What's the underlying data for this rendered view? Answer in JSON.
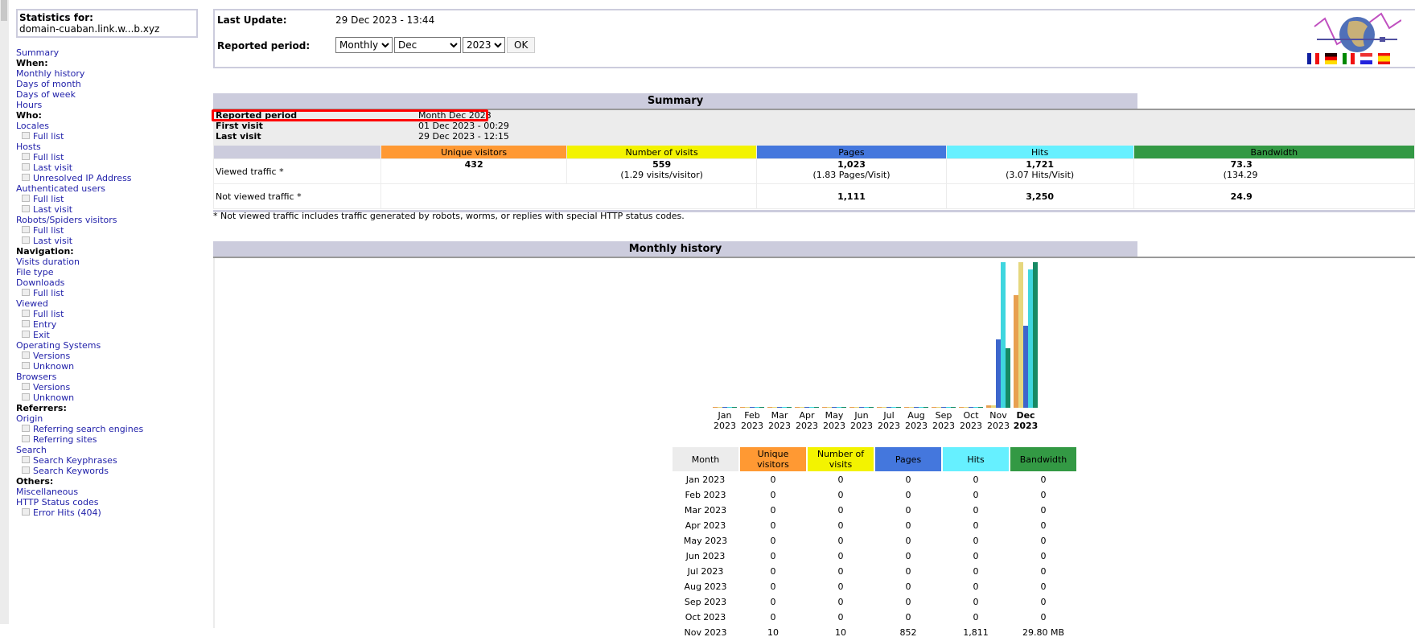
{
  "sidebar": {
    "stats_label": "Statistics for:",
    "domain": "domain-cuaban.link.w...b.xyz",
    "items": [
      {
        "type": "link",
        "label": "Summary"
      },
      {
        "type": "section",
        "label": "When:"
      },
      {
        "type": "link",
        "label": "Monthly history"
      },
      {
        "type": "link",
        "label": "Days of month"
      },
      {
        "type": "link",
        "label": "Days of week"
      },
      {
        "type": "link",
        "label": "Hours"
      },
      {
        "type": "section",
        "label": "Who:"
      },
      {
        "type": "link",
        "label": "Locales"
      },
      {
        "type": "sub",
        "label": "Full list"
      },
      {
        "type": "link",
        "label": "Hosts"
      },
      {
        "type": "sub",
        "label": "Full list"
      },
      {
        "type": "sub",
        "label": "Last visit"
      },
      {
        "type": "sub",
        "label": "Unresolved IP Address"
      },
      {
        "type": "link",
        "label": "Authenticated users"
      },
      {
        "type": "sub",
        "label": "Full list"
      },
      {
        "type": "sub",
        "label": "Last visit"
      },
      {
        "type": "link",
        "label": "Robots/Spiders visitors"
      },
      {
        "type": "sub",
        "label": "Full list"
      },
      {
        "type": "sub",
        "label": "Last visit"
      },
      {
        "type": "section",
        "label": "Navigation:"
      },
      {
        "type": "link",
        "label": "Visits duration"
      },
      {
        "type": "link",
        "label": "File type"
      },
      {
        "type": "link",
        "label": "Downloads"
      },
      {
        "type": "sub",
        "label": "Full list"
      },
      {
        "type": "link",
        "label": "Viewed"
      },
      {
        "type": "sub",
        "label": "Full list"
      },
      {
        "type": "sub",
        "label": "Entry"
      },
      {
        "type": "sub",
        "label": "Exit"
      },
      {
        "type": "link",
        "label": "Operating Systems"
      },
      {
        "type": "sub",
        "label": "Versions"
      },
      {
        "type": "sub",
        "label": "Unknown"
      },
      {
        "type": "link",
        "label": "Browsers"
      },
      {
        "type": "sub",
        "label": "Versions"
      },
      {
        "type": "sub",
        "label": "Unknown"
      },
      {
        "type": "section",
        "label": "Referrers:"
      },
      {
        "type": "link",
        "label": "Origin"
      },
      {
        "type": "sub",
        "label": "Referring search engines"
      },
      {
        "type": "sub",
        "label": "Referring sites"
      },
      {
        "type": "link",
        "label": "Search"
      },
      {
        "type": "sub",
        "label": "Search Keyphrases"
      },
      {
        "type": "sub",
        "label": "Search Keywords"
      },
      {
        "type": "section",
        "label": "Others:"
      },
      {
        "type": "link",
        "label": "Miscellaneous"
      },
      {
        "type": "link",
        "label": "HTTP Status codes"
      },
      {
        "type": "sub",
        "label": "Error Hits (404)"
      }
    ]
  },
  "header": {
    "last_update_label": "Last Update:",
    "last_update_value": "29 Dec 2023 - 13:44",
    "period_label": "Reported period:",
    "period_type": "Monthly",
    "month": "Dec",
    "year": "2023",
    "ok_label": "OK",
    "flags": [
      "fr",
      "de",
      "it",
      "nl",
      "es"
    ]
  },
  "summary": {
    "title": "Summary",
    "reported_period_label": "Reported period",
    "reported_period_value": "Month Dec 2023",
    "first_visit_label": "First visit",
    "first_visit_value": "01 Dec 2023 - 00:29",
    "last_visit_label": "Last visit",
    "last_visit_value": "29 Dec 2023 - 12:15",
    "columns": [
      "Unique visitors",
      "Number of visits",
      "Pages",
      "Hits",
      "Bandwidth"
    ],
    "viewed_label": "Viewed traffic *",
    "viewed": {
      "unique": "432",
      "visits": "559",
      "visits_sub": "(1.29 visits/visitor)",
      "pages": "1,023",
      "pages_sub": "(1.83 Pages/Visit)",
      "hits": "1,721",
      "hits_sub": "(3.07 Hits/Visit)",
      "bandwidth": "73.3",
      "bandwidth_sub": "(134.29"
    },
    "not_viewed_label": "Not viewed traffic *",
    "not_viewed": {
      "pages": "1,111",
      "hits": "3,250",
      "bandwidth": "24.9"
    },
    "footnote": "* Not viewed traffic includes traffic generated by robots, worms, or replies with special HTTP status codes."
  },
  "colors": {
    "visitors": "#ff9933",
    "visits": "#f3f300",
    "pages": "#4477dd",
    "hits": "#66f0ff",
    "bandwidth": "#339944",
    "header_bg": "#ccccdd",
    "highlight": "#ff0000"
  },
  "monthly": {
    "title": "Monthly history",
    "columns": [
      "Month",
      "Unique visitors",
      "Number of visits",
      "Pages",
      "Hits",
      "Bandwidth"
    ],
    "rows": [
      [
        "Jan 2023",
        "0",
        "0",
        "0",
        "0",
        "0"
      ],
      [
        "Feb 2023",
        "0",
        "0",
        "0",
        "0",
        "0"
      ],
      [
        "Mar 2023",
        "0",
        "0",
        "0",
        "0",
        "0"
      ],
      [
        "Apr 2023",
        "0",
        "0",
        "0",
        "0",
        "0"
      ],
      [
        "May 2023",
        "0",
        "0",
        "0",
        "0",
        "0"
      ],
      [
        "Jun 2023",
        "0",
        "0",
        "0",
        "0",
        "0"
      ],
      [
        "Jul 2023",
        "0",
        "0",
        "0",
        "0",
        "0"
      ],
      [
        "Aug 2023",
        "0",
        "0",
        "0",
        "0",
        "0"
      ],
      [
        "Sep 2023",
        "0",
        "0",
        "0",
        "0",
        "0"
      ],
      [
        "Oct 2023",
        "0",
        "0",
        "0",
        "0",
        "0"
      ],
      [
        "Nov 2023",
        "10",
        "10",
        "852",
        "1,811",
        "29.80 MB"
      ]
    ]
  },
  "chart_data": {
    "type": "bar",
    "categories": [
      [
        "Jan",
        "2023"
      ],
      [
        "Feb",
        "2023"
      ],
      [
        "Mar",
        "2023"
      ],
      [
        "Apr",
        "2023"
      ],
      [
        "May",
        "2023"
      ],
      [
        "Jun",
        "2023"
      ],
      [
        "Jul",
        "2023"
      ],
      [
        "Aug",
        "2023"
      ],
      [
        "Sep",
        "2023"
      ],
      [
        "Oct",
        "2023"
      ],
      [
        "Nov",
        "2023"
      ],
      [
        "Dec",
        "2023"
      ]
    ],
    "highlight_category": "Dec",
    "series": [
      {
        "key": "visitors",
        "values": [
          0,
          0,
          0,
          0,
          0,
          0,
          0,
          0,
          0,
          0,
          10,
          432
        ],
        "color": "#e8a050",
        "scale_group": "visits"
      },
      {
        "key": "visits",
        "values": [
          0,
          0,
          0,
          0,
          0,
          0,
          0,
          0,
          0,
          0,
          10,
          559
        ],
        "color": "#e6d77e",
        "scale_group": "visits"
      },
      {
        "key": "pages",
        "values": [
          0,
          0,
          0,
          0,
          0,
          0,
          0,
          0,
          0,
          0,
          852,
          1023
        ],
        "color": "#3d66cc",
        "scale_group": "hits"
      },
      {
        "key": "hits",
        "values": [
          0,
          0,
          0,
          0,
          0,
          0,
          0,
          0,
          0,
          0,
          1811,
          1721
        ],
        "color": "#3fd6df",
        "scale_group": "hits"
      },
      {
        "key": "bandwidth",
        "values": [
          0,
          0,
          0,
          0,
          0,
          0,
          0,
          0,
          0,
          0,
          29.8,
          73.3
        ],
        "color": "#168a64",
        "scale_group": "bandwidth",
        "unit": "MB"
      }
    ]
  }
}
